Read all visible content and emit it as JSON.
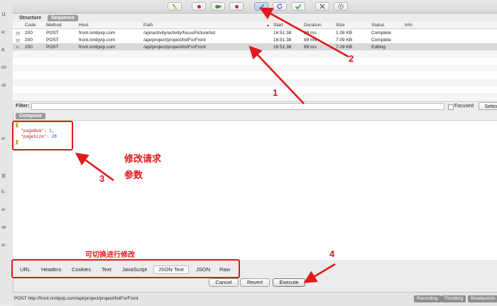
{
  "left_fragments": [
    "11",
    "er",
    "iti",
    "00",
    "sit",
    "",
    "",
    "er",
    "",
    "我",
    "E-",
    "or",
    "ok",
    "or"
  ],
  "toolbar": {
    "buttons": [
      {
        "name": "broom-icon",
        "active": false
      },
      {
        "name": "record-icon",
        "active": false
      },
      {
        "name": "turtle-icon",
        "active": false
      },
      {
        "name": "breakpoint-icon",
        "active": false
      },
      {
        "name": "compose-pen-icon",
        "active": true
      },
      {
        "name": "repeat-icon",
        "active": false
      },
      {
        "name": "validate-check-icon",
        "active": false
      },
      {
        "name": "tools-icon",
        "active": false
      },
      {
        "name": "settings-gear-icon",
        "active": false
      }
    ]
  },
  "view_tabs": {
    "structure": "Structure",
    "sequence": "Sequence"
  },
  "table": {
    "headers": {
      "code": "Code",
      "method": "Method",
      "host": "Host",
      "path": "Path",
      "start": "Start",
      "duration": "Duration",
      "size": "Size",
      "status": "Status",
      "info": "Info"
    },
    "rows": [
      {
        "code": "200",
        "method": "POST",
        "host": "front.nmbjvip.com",
        "path": "/api/activity/activity/focusPicture/list",
        "start": "16:51:38",
        "duration": "89 ms",
        "size": "1.08 KB",
        "status": "Complete"
      },
      {
        "code": "200",
        "method": "POST",
        "host": "front.nmbjvip.com",
        "path": "/api/project/project/listForFront",
        "start": "16:51:38",
        "duration": "89 ms",
        "size": "7.09 KB",
        "status": "Complete"
      },
      {
        "code": "200",
        "method": "POST",
        "host": "front.nmbjvip.com",
        "path": "/api/project/project/listForFront",
        "start": "16:51:38",
        "duration": "89 ms",
        "size": "7.09 KB",
        "status": "Editing"
      }
    ]
  },
  "filter": {
    "label": "Filter:",
    "value": "",
    "focused_label": "Focused",
    "settings_label": "Settings"
  },
  "compose": {
    "tab_label": "Compose",
    "code": {
      "open": "{",
      "key1": "\"pageNum\"",
      "val1": "1",
      "key2": "\"pageSize\"",
      "val2": "20",
      "close": "}"
    }
  },
  "bottom_tabs": [
    {
      "label": "URL",
      "selected": false
    },
    {
      "label": "Headers",
      "selected": false
    },
    {
      "label": "Cookies",
      "selected": false
    },
    {
      "label": "Text",
      "selected": false
    },
    {
      "label": "JavaScript",
      "selected": false
    },
    {
      "label": "JSON Text",
      "selected": true
    },
    {
      "label": "JSON",
      "selected": false
    },
    {
      "label": "Raw",
      "selected": false
    }
  ],
  "actions": {
    "cancel": "Cancel",
    "revert": "Revert",
    "execute": "Execute"
  },
  "status": {
    "url": "POST http://front.nmbjvip.com/api/project/project/listForFront",
    "recording": "Recording",
    "throttling": "Throttling",
    "breakpoints": "Breakpoints"
  },
  "annotations": {
    "n1": "1",
    "n2": "2",
    "n3": "3",
    "n4": "4",
    "modify_line1": "修改请求",
    "modify_line2": "参数",
    "switch_hint": "可切换进行修改"
  },
  "colors": {
    "annotation_red": "#e0191c",
    "selected_row": "#d8d8d8"
  }
}
